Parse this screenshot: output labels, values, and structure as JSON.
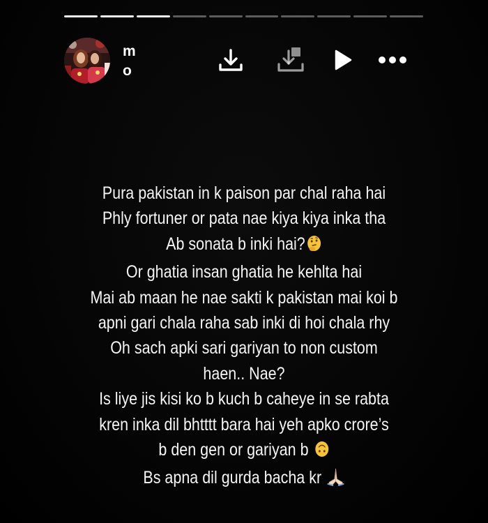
{
  "story": {
    "progress": {
      "total": 10,
      "completed": 3
    },
    "username": "mo",
    "actions": {
      "download_icon": "download-icon",
      "save_icon": "save-to-collection-icon",
      "play_icon": "play-icon",
      "more_icon": "more-icon"
    },
    "caption": {
      "line1": "Pura pakistan in k paison par chal raha hai",
      "line2": "Phly fortuner or pata nae kiya kiya inka tha",
      "line3": "Ab sonata b inki hai?",
      "line4": "Or ghatia insan ghatia he kehlta hai",
      "line5": "Mai ab maan he nae sakti k pakistan mai koi b",
      "line6": "apni gari chala raha sab inki di hoi chala rhy",
      "line7": "Oh sach apki sari gariyan to non custom",
      "line8": "haen.. Nae?",
      "line9": "Is liye jis kisi ko b kuch b caheye in se rabta",
      "line10": "kren inka dil bhtttt bara hai  yeh apko crore’s",
      "line11": "b den gen or gariyan b",
      "line12": "Bs apna dil gurda bacha kr"
    },
    "emojis": {
      "thinking": "thinking-face-emoji",
      "upside_down": "upside-down-face-emoji",
      "pray": "folded-hands-emoji"
    }
  }
}
